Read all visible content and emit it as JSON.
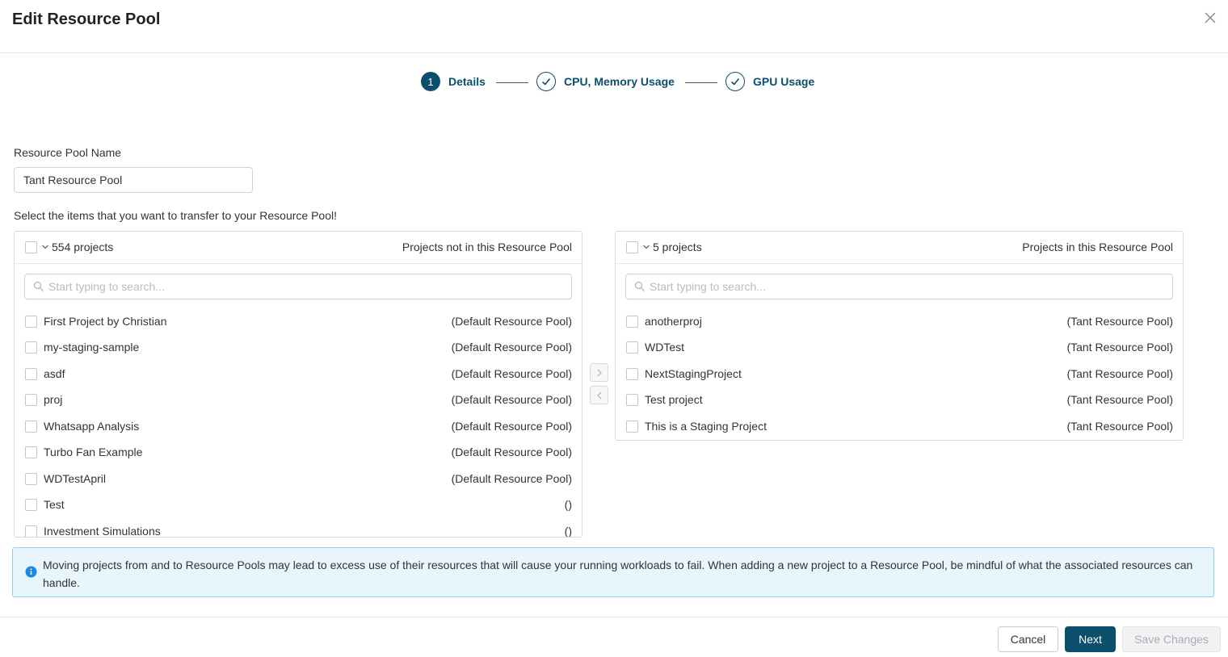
{
  "dialog": {
    "title": "Edit Resource Pool"
  },
  "stepper": {
    "steps": [
      {
        "number": "1",
        "label": "Details",
        "state": "active"
      },
      {
        "number": "",
        "label": "CPU, Memory Usage",
        "state": "complete"
      },
      {
        "number": "",
        "label": "GPU Usage",
        "state": "complete"
      }
    ]
  },
  "form": {
    "name_label": "Resource Pool Name",
    "name_value": "Tant Resource Pool",
    "instruction": "Select the items that you want to transfer to your Resource Pool!"
  },
  "left_panel": {
    "count": "554 projects",
    "title": "Projects not in this Resource Pool",
    "search_placeholder": "Start typing to search...",
    "items": [
      {
        "name": "First Project by Christian",
        "pool": "(Default Resource Pool)"
      },
      {
        "name": "my-staging-sample",
        "pool": "(Default Resource Pool)"
      },
      {
        "name": "asdf",
        "pool": "(Default Resource Pool)"
      },
      {
        "name": "proj",
        "pool": "(Default Resource Pool)"
      },
      {
        "name": "Whatsapp Analysis",
        "pool": "(Default Resource Pool)"
      },
      {
        "name": "Turbo Fan Example",
        "pool": "(Default Resource Pool)"
      },
      {
        "name": "WDTestApril",
        "pool": "(Default Resource Pool)"
      },
      {
        "name": "Test",
        "pool": "()"
      },
      {
        "name": "Investment Simulations",
        "pool": "()"
      }
    ]
  },
  "right_panel": {
    "count": "5 projects",
    "title": "Projects in this Resource Pool",
    "search_placeholder": "Start typing to search...",
    "items": [
      {
        "name": "anotherproj",
        "pool": "(Tant Resource Pool)"
      },
      {
        "name": "WDTest",
        "pool": "(Tant Resource Pool)"
      },
      {
        "name": "NextStagingProject",
        "pool": "(Tant Resource Pool)"
      },
      {
        "name": "Test project",
        "pool": "(Tant Resource Pool)"
      },
      {
        "name": "This is a Staging Project",
        "pool": "(Tant Resource Pool)"
      }
    ]
  },
  "alert": {
    "icon": "info-icon",
    "message": "Moving projects from and to Resource Pools may lead to excess use of their resources that will cause your running workloads to fail. When adding a new project to a Resource Pool, be mindful of what the associated resources can handle."
  },
  "footer": {
    "cancel_label": "Cancel",
    "next_label": "Next",
    "save_label": "Save Changes"
  },
  "colors": {
    "primary": "#0b4f6c",
    "alert_background": "#e8f6fc",
    "alert_border": "#8fd0ea",
    "info_icon": "#1e88e5"
  }
}
